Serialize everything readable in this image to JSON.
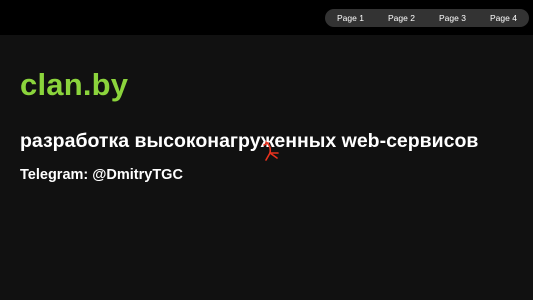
{
  "nav": {
    "items": [
      {
        "label": "Page 1"
      },
      {
        "label": "Page 2"
      },
      {
        "label": "Page 3"
      },
      {
        "label": "Page 4"
      }
    ]
  },
  "hero": {
    "title": "clan.by",
    "tagline": "разработка высоконагруженных web-сервисов",
    "contact": "Telegram: @DmitryTGC"
  },
  "colors": {
    "background": "#111111",
    "topbar": "#000000",
    "nav_pill": "#333333",
    "title_accent": "#8bd43c",
    "text": "#ffffff",
    "cursor": "#e8321e"
  },
  "cursor": {
    "icon": "busy-cursor-icon"
  }
}
